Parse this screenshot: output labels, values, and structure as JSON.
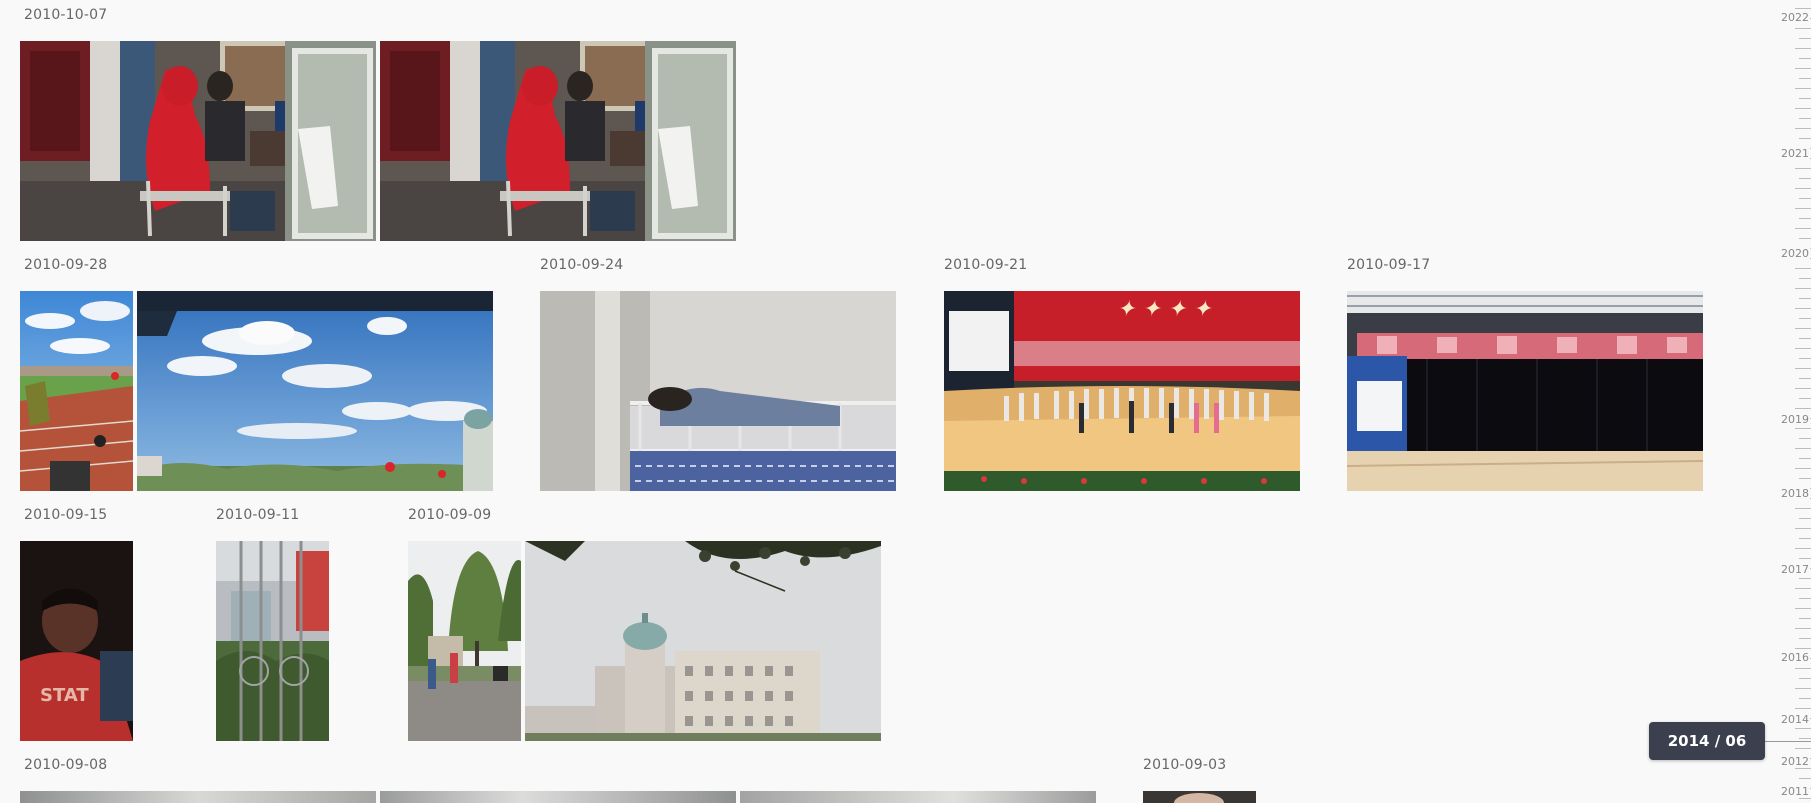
{
  "groups": [
    {
      "date": "2010-10-07",
      "photos": [
        "dorm-room-red-hoodie",
        "dorm-room-red-hoodie-duplicate"
      ]
    },
    {
      "date": "2010-09-28",
      "photos": [
        "stadium-track-balloons",
        "blue-sky-clouds-campus"
      ]
    },
    {
      "date": "2010-09-24",
      "photos": [
        "dorm-bunk-bed-sleeping"
      ]
    },
    {
      "date": "2010-09-21",
      "photos": [
        "stage-choir-performance"
      ]
    },
    {
      "date": "2010-09-17",
      "photos": [
        "empty-stage-hall"
      ]
    },
    {
      "date": "2010-09-15",
      "photos": [
        "dark-portrait-red-shirt"
      ]
    },
    {
      "date": "2010-09-11",
      "photos": [
        "window-bars-building"
      ]
    },
    {
      "date": "2010-09-09",
      "photos": [
        "campus-walkway-trees",
        "domed-campus-building"
      ]
    },
    {
      "date": "2010-09-08",
      "photos": [
        "partial-photo-1",
        "partial-photo-2",
        "partial-photo-3"
      ]
    },
    {
      "date": "2010-09-03",
      "photos": [
        "partial-portrait"
      ]
    }
  ],
  "timeline": {
    "years": [
      "2022",
      "2021",
      "2020",
      "2019",
      "2018",
      "2017",
      "2016",
      "2014",
      "2012",
      "2011"
    ],
    "current": "2014 / 06"
  }
}
